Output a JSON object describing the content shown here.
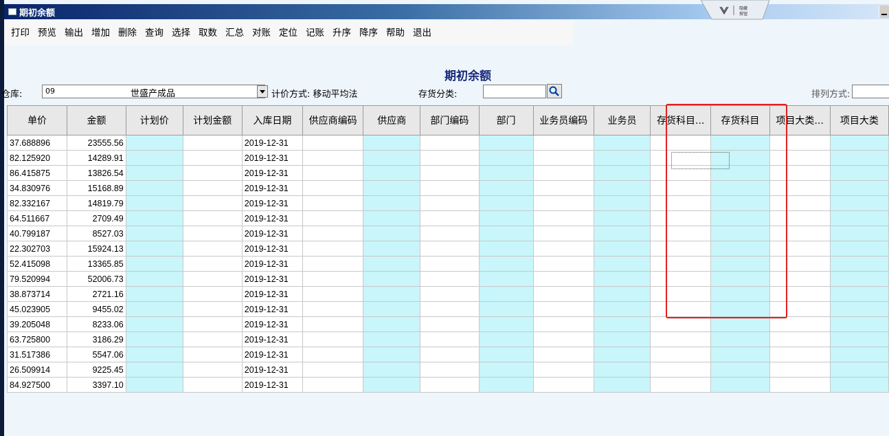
{
  "window": {
    "title": "期初余额",
    "ribbon_label": "隐藏\n按钮"
  },
  "menu": [
    "打印",
    "预览",
    "输出",
    "增加",
    "删除",
    "查询",
    "选择",
    "取数",
    "汇总",
    "对账",
    "定位",
    "记账",
    "升序",
    "降序",
    "帮助",
    "退出"
  ],
  "page_title": "期初余额",
  "filters": {
    "warehouse_label": "仓库:",
    "warehouse_code": "09",
    "warehouse_name": "世盛产成品",
    "valuation_label": "计价方式: 移动平均法",
    "category_label": "存货分类:",
    "category_value": "",
    "sort_label": "排列方式:",
    "sort_value": ""
  },
  "colors": {
    "cyan_column": "#c8f6fa",
    "highlight": "#e02020",
    "title_blue": "#1a2a7a"
  },
  "columns": [
    {
      "label": "单价",
      "width": 88,
      "bg": "white",
      "key": "price"
    },
    {
      "label": "金额",
      "width": 88,
      "bg": "white",
      "key": "amount"
    },
    {
      "label": "计划价",
      "width": 88,
      "bg": "cyan",
      "key": ""
    },
    {
      "label": "计划金额",
      "width": 88,
      "bg": "white",
      "key": ""
    },
    {
      "label": "入库日期",
      "width": 88,
      "bg": "white",
      "key": "date"
    },
    {
      "label": "供应商编码",
      "width": 87,
      "bg": "white",
      "key": ""
    },
    {
      "label": "供应商",
      "width": 88,
      "bg": "cyan",
      "key": ""
    },
    {
      "label": "部门编码",
      "width": 87,
      "bg": "white",
      "key": ""
    },
    {
      "label": "部门",
      "width": 87,
      "bg": "cyan",
      "key": ""
    },
    {
      "label": "业务员编码",
      "width": 87,
      "bg": "white",
      "key": ""
    },
    {
      "label": "业务员",
      "width": 87,
      "bg": "cyan",
      "key": ""
    },
    {
      "label": "存货科目...",
      "width": 87,
      "bg": "white",
      "key": ""
    },
    {
      "label": "存货科目",
      "width": 87,
      "bg": "cyan",
      "key": ""
    },
    {
      "label": "项目大类...",
      "width": 87,
      "bg": "white",
      "key": ""
    },
    {
      "label": "项目大类",
      "width": 87,
      "bg": "cyan",
      "key": ""
    }
  ],
  "rows": [
    {
      "price": "37.688896",
      "amount": "23555.56",
      "date": "2019-12-31"
    },
    {
      "price": "82.125920",
      "amount": "14289.91",
      "date": "2019-12-31"
    },
    {
      "price": "86.415875",
      "amount": "13826.54",
      "date": "2019-12-31"
    },
    {
      "price": "34.830976",
      "amount": "15168.89",
      "date": "2019-12-31"
    },
    {
      "price": "82.332167",
      "amount": "14819.79",
      "date": "2019-12-31"
    },
    {
      "price": "64.511667",
      "amount": "2709.49",
      "date": "2019-12-31"
    },
    {
      "price": "40.799187",
      "amount": "8527.03",
      "date": "2019-12-31"
    },
    {
      "price": "22.302703",
      "amount": "15924.13",
      "date": "2019-12-31"
    },
    {
      "price": "52.415098",
      "amount": "13365.85",
      "date": "2019-12-31"
    },
    {
      "price": "79.520994",
      "amount": "52006.73",
      "date": "2019-12-31"
    },
    {
      "price": "38.873714",
      "amount": "2721.16",
      "date": "2019-12-31"
    },
    {
      "price": "45.023905",
      "amount": "9455.02",
      "date": "2019-12-31"
    },
    {
      "price": "39.205048",
      "amount": "8233.06",
      "date": "2019-12-31"
    },
    {
      "price": "63.725800",
      "amount": "3186.29",
      "date": "2019-12-31"
    },
    {
      "price": "31.517386",
      "amount": "5547.06",
      "date": "2019-12-31"
    },
    {
      "price": "26.509914",
      "amount": "9225.45",
      "date": "2019-12-31"
    },
    {
      "price": "84.927500",
      "amount": "3397.10",
      "date": "2019-12-31"
    }
  ]
}
